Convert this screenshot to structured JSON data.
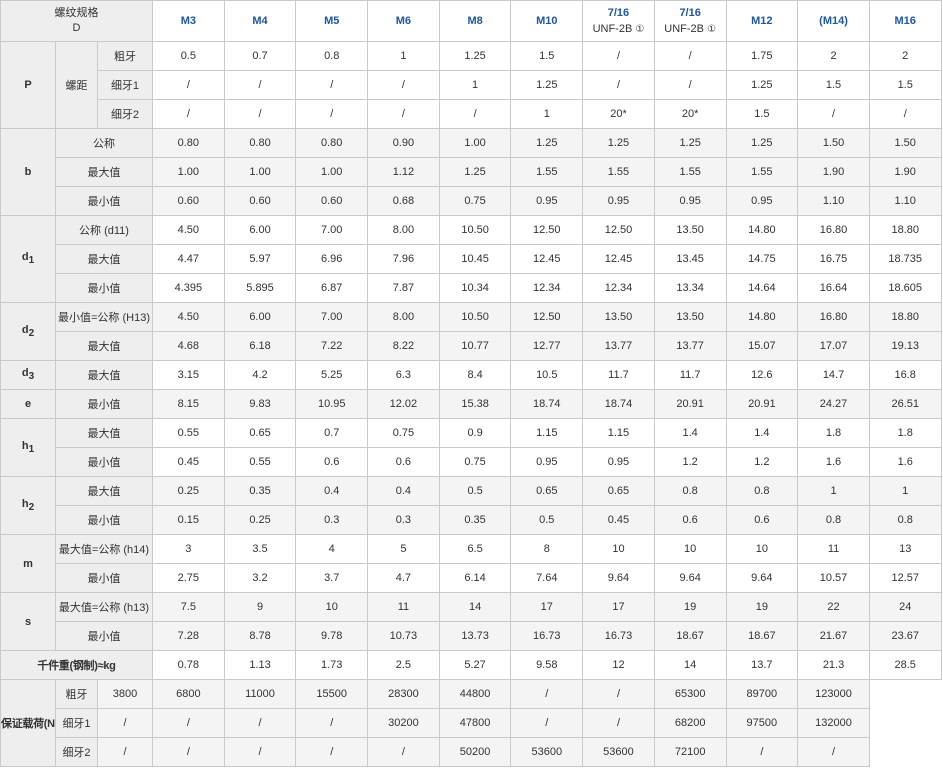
{
  "header": {
    "corner_line1": "螺纹规格",
    "corner_line2": "D",
    "sizes": [
      {
        "name": "M3"
      },
      {
        "name": "M4"
      },
      {
        "name": "M5"
      },
      {
        "name": "M6"
      },
      {
        "name": "M8"
      },
      {
        "name": "M10"
      },
      {
        "name": "7/16",
        "sub": "UNF-2B",
        "mark": "①"
      },
      {
        "name": "7/16",
        "sub": "UNF-2B",
        "mark": "①"
      },
      {
        "name": "M12"
      },
      {
        "name": "(M14)"
      },
      {
        "name": "M16"
      }
    ]
  },
  "groups": {
    "P": {
      "symbol": "P",
      "subgroup": "螺距"
    },
    "b": {
      "symbol": "b"
    },
    "d1": {
      "symbol": "d",
      "sub": "1"
    },
    "d2": {
      "symbol": "d",
      "sub": "2"
    },
    "d3": {
      "symbol": "d",
      "sub": "3"
    },
    "e": {
      "symbol": "e"
    },
    "h1": {
      "symbol": "h",
      "sub": "1"
    },
    "h2": {
      "symbol": "h",
      "sub": "2"
    },
    "m": {
      "symbol": "m"
    },
    "s": {
      "symbol": "s"
    },
    "w": {
      "label": "千件重(钢制)≈kg"
    },
    "load": {
      "label": "保证载荷(N)"
    }
  },
  "rows": [
    {
      "group": "P",
      "label": "粗牙",
      "values": [
        "0.5",
        "0.7",
        "0.8",
        "1",
        "1.25",
        "1.5",
        "/",
        "/",
        "1.75",
        "2",
        "2"
      ]
    },
    {
      "group": "P",
      "label": "细牙1",
      "values": [
        "/",
        "/",
        "/",
        "/",
        "1",
        "1.25",
        "/",
        "/",
        "1.25",
        "1.5",
        "1.5"
      ]
    },
    {
      "group": "P",
      "label": "细牙2",
      "values": [
        "/",
        "/",
        "/",
        "/",
        "/",
        "1",
        "20*",
        "20*",
        "1.5",
        "/",
        "/"
      ]
    },
    {
      "group": "b",
      "label": "公称",
      "values": [
        "0.80",
        "0.80",
        "0.80",
        "0.90",
        "1.00",
        "1.25",
        "1.25",
        "1.25",
        "1.25",
        "1.50",
        "1.50"
      ]
    },
    {
      "group": "b",
      "label": "最大值",
      "values": [
        "1.00",
        "1.00",
        "1.00",
        "1.12",
        "1.25",
        "1.55",
        "1.55",
        "1.55",
        "1.55",
        "1.90",
        "1.90"
      ]
    },
    {
      "group": "b",
      "label": "最小值",
      "values": [
        "0.60",
        "0.60",
        "0.60",
        "0.68",
        "0.75",
        "0.95",
        "0.95",
        "0.95",
        "0.95",
        "1.10",
        "1.10"
      ]
    },
    {
      "group": "d1",
      "label": "公称 (d11)",
      "values": [
        "4.50",
        "6.00",
        "7.00",
        "8.00",
        "10.50",
        "12.50",
        "12.50",
        "13.50",
        "14.80",
        "16.80",
        "18.80"
      ]
    },
    {
      "group": "d1",
      "label": "最大值",
      "values": [
        "4.47",
        "5.97",
        "6.96",
        "7.96",
        "10.45",
        "12.45",
        "12.45",
        "13.45",
        "14.75",
        "16.75",
        "18.735"
      ]
    },
    {
      "group": "d1",
      "label": "最小值",
      "values": [
        "4.395",
        "5.895",
        "6.87",
        "7.87",
        "10.34",
        "12.34",
        "12.34",
        "13.34",
        "14.64",
        "16.64",
        "18.605"
      ]
    },
    {
      "group": "d2",
      "label": "最小值=公称 (H13)",
      "values": [
        "4.50",
        "6.00",
        "7.00",
        "8.00",
        "10.50",
        "12.50",
        "13.50",
        "13.50",
        "14.80",
        "16.80",
        "18.80"
      ]
    },
    {
      "group": "d2",
      "label": "最大值",
      "values": [
        "4.68",
        "6.18",
        "7.22",
        "8.22",
        "10.77",
        "12.77",
        "13.77",
        "13.77",
        "15.07",
        "17.07",
        "19.13"
      ]
    },
    {
      "group": "d3",
      "label": "最大值",
      "values": [
        "3.15",
        "4.2",
        "5.25",
        "6.3",
        "8.4",
        "10.5",
        "11.7",
        "11.7",
        "12.6",
        "14.7",
        "16.8"
      ]
    },
    {
      "group": "e",
      "label": "最小值",
      "values": [
        "8.15",
        "9.83",
        "10.95",
        "12.02",
        "15.38",
        "18.74",
        "18.74",
        "20.91",
        "20.91",
        "24.27",
        "26.51"
      ]
    },
    {
      "group": "h1",
      "label": "最大值",
      "values": [
        "0.55",
        "0.65",
        "0.7",
        "0.75",
        "0.9",
        "1.15",
        "1.15",
        "1.4",
        "1.4",
        "1.8",
        "1.8"
      ]
    },
    {
      "group": "h1",
      "label": "最小值",
      "values": [
        "0.45",
        "0.55",
        "0.6",
        "0.6",
        "0.75",
        "0.95",
        "0.95",
        "1.2",
        "1.2",
        "1.6",
        "1.6"
      ]
    },
    {
      "group": "h2",
      "label": "最大值",
      "values": [
        "0.25",
        "0.35",
        "0.4",
        "0.4",
        "0.5",
        "0.65",
        "0.65",
        "0.8",
        "0.8",
        "1",
        "1"
      ]
    },
    {
      "group": "h2",
      "label": "最小值",
      "values": [
        "0.15",
        "0.25",
        "0.3",
        "0.3",
        "0.35",
        "0.5",
        "0.45",
        "0.6",
        "0.6",
        "0.8",
        "0.8"
      ]
    },
    {
      "group": "m",
      "label": "最大值=公称 (h14)",
      "values": [
        "3",
        "3.5",
        "4",
        "5",
        "6.5",
        "8",
        "10",
        "10",
        "10",
        "11",
        "13"
      ]
    },
    {
      "group": "m",
      "label": "最小值",
      "values": [
        "2.75",
        "3.2",
        "3.7",
        "4.7",
        "6.14",
        "7.64",
        "9.64",
        "9.64",
        "9.64",
        "10.57",
        "12.57"
      ]
    },
    {
      "group": "s",
      "label": "最大值=公称 (h13)",
      "values": [
        "7.5",
        "9",
        "10",
        "11",
        "14",
        "17",
        "17",
        "19",
        "19",
        "22",
        "24"
      ]
    },
    {
      "group": "s",
      "label": "最小值",
      "values": [
        "7.28",
        "8.78",
        "9.78",
        "10.73",
        "13.73",
        "16.73",
        "16.73",
        "18.67",
        "18.67",
        "21.67",
        "23.67"
      ]
    },
    {
      "group": "w",
      "label": "",
      "values": [
        "0.78",
        "1.13",
        "1.73",
        "2.5",
        "5.27",
        "9.58",
        "12",
        "14",
        "13.7",
        "21.3",
        "28.5"
      ]
    },
    {
      "group": "load",
      "label": "粗牙",
      "values": [
        "3800",
        "6800",
        "11000",
        "15500",
        "28300",
        "44800",
        "/",
        "/",
        "65300",
        "89700",
        "123000"
      ]
    },
    {
      "group": "load",
      "label": "细牙1",
      "values": [
        "/",
        "/",
        "/",
        "/",
        "30200",
        "47800",
        "/",
        "/",
        "68200",
        "97500",
        "132000"
      ]
    },
    {
      "group": "load",
      "label": "细牙2",
      "values": [
        "/",
        "/",
        "/",
        "/",
        "/",
        "50200",
        "53600",
        "53600",
        "72100",
        "/",
        "/"
      ]
    }
  ]
}
